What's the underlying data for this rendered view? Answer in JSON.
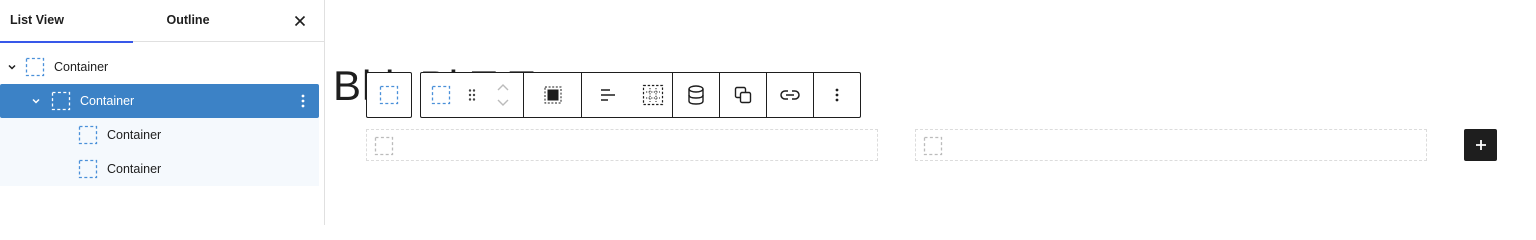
{
  "sidebar": {
    "tabs": [
      {
        "label": "List View",
        "active": true
      },
      {
        "label": "Outline",
        "active": false
      }
    ],
    "close_icon": "close-icon",
    "tree": [
      {
        "label": "Container",
        "level": 1,
        "expanded": true,
        "selected": false
      },
      {
        "label": "Container",
        "level": 2,
        "expanded": true,
        "selected": true
      },
      {
        "label": "Container",
        "level": 3,
        "selected": false
      },
      {
        "label": "Container",
        "level": 3,
        "selected": false
      }
    ]
  },
  "canvas": {
    "background_heading": "Bl   k  Pl   T   T",
    "toolbar": {
      "buttons": [
        "select-parent-icon",
        "block-type-icon",
        "drag-handle-icon",
        "move-up-down-icon",
        "fill-color-icon",
        "justify-icon",
        "layout-grid-icon",
        "database-icon",
        "duplicate-icon",
        "link-icon",
        "more-options-icon"
      ]
    },
    "add_block_icon": "plus-icon"
  },
  "colors": {
    "selected_row": "#3c82c6",
    "sub_row": "#f5f9fd",
    "tab_indicator": "#3858e9",
    "block_icon_blue": "#4a90d9",
    "toolbar_border": "#1e1e1e"
  }
}
